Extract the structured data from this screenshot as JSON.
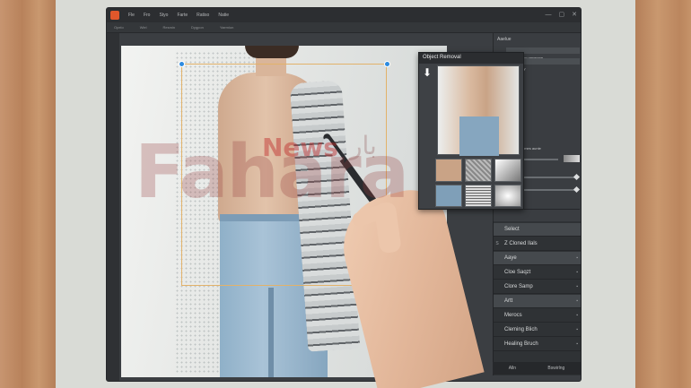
{
  "menubar": {
    "items": [
      "Fle",
      "Fro",
      "Styo",
      "Farte",
      "Ratiso",
      "Natie"
    ],
    "controls": [
      "—",
      "▢",
      "✕"
    ]
  },
  "options_bar": {
    "items": [
      "Opelo",
      "Wiel",
      "Resmin",
      "Dygpon",
      "Yaemion"
    ]
  },
  "object_removal": {
    "title": "Object Removal"
  },
  "right_panel": {
    "header": "Aaelue",
    "field1": "Ramine Iem pesemne",
    "field2": "Snvonsetiy",
    "label": "Sormes aunte"
  },
  "layers": [
    {
      "vis": "",
      "name": "Select",
      "selected": true
    },
    {
      "vis": "S",
      "name": "Z  Cloned Ilals",
      "selected": false
    },
    {
      "vis": "",
      "name": "Aaye",
      "selected": true
    },
    {
      "vis": "",
      "name": "Cloe Saqzt",
      "selected": false
    },
    {
      "vis": "",
      "name": "Clore Samp",
      "selected": false
    },
    {
      "vis": "",
      "name": "Artt",
      "selected": true
    },
    {
      "vis": "",
      "name": "Merocs",
      "selected": false
    },
    {
      "vis": "",
      "name": "Cleming Blich",
      "selected": false
    },
    {
      "vis": "",
      "name": "Healing Bruch",
      "selected": false
    }
  ],
  "layer_footer": [
    "Alln",
    "Bswirlng"
  ],
  "watermark": {
    "main": "Fahara",
    "news": "News",
    "arabic": "بار"
  },
  "colors": {
    "accent_orange": "#e0572b",
    "handle_blue": "#2d8be0",
    "selection": "#e2b26a",
    "panel_bg": "#3b3e42"
  },
  "icons": [
    "app-logo-icon",
    "minimize-icon",
    "maximize-icon",
    "close-icon",
    "down-arrow-icon",
    "eye-icon",
    "lock-icon"
  ]
}
